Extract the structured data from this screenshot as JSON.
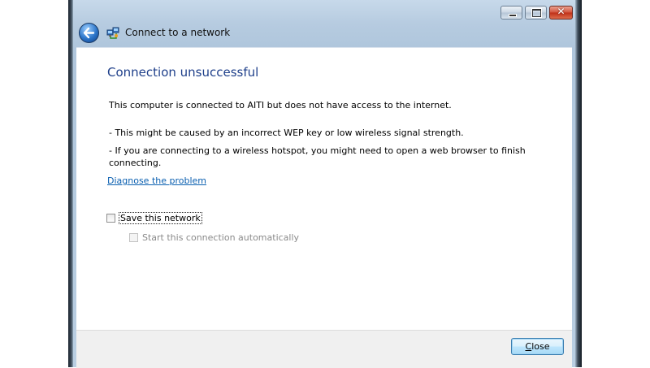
{
  "window": {
    "title": "Connect to a network",
    "caption_buttons": {
      "minimize_icon": "minimize-icon",
      "maximize_icon": "maximize-icon",
      "close_glyph": "✕"
    },
    "back_icon": "back-arrow-icon",
    "network_icon": "wireless-network-icon"
  },
  "content": {
    "heading": "Connection unsuccessful",
    "message": "This computer is connected to AITI but does not have access to the internet.",
    "cause_wep": "- This might be caused by an incorrect WEP key or low wireless signal strength.",
    "cause_hotspot": "- If you are connecting to a wireless hotspot, you might need to open a web browser to finish connecting.",
    "diagnose_link": "Diagnose the problem",
    "save_network": {
      "label": "Save this network",
      "checked": false
    },
    "auto_start": {
      "label": "Start this connection automatically",
      "checked": false,
      "disabled": true
    }
  },
  "footer": {
    "close_button": {
      "first_letter": "C",
      "rest": "lose"
    }
  },
  "colors": {
    "heading": "#1e3f8a",
    "link": "#0a5fb0",
    "frame_glass": "#b6cbe0"
  }
}
